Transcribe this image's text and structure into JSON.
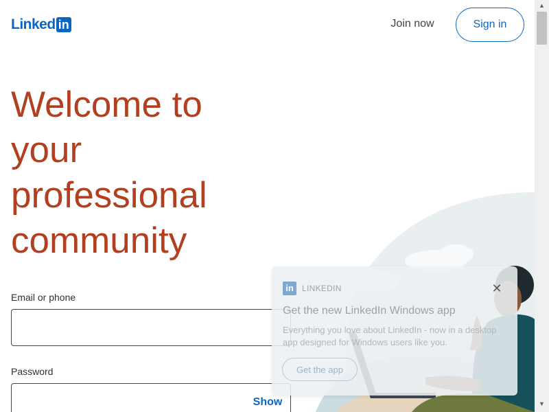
{
  "header": {
    "logo_text": "Linked",
    "logo_box_text": "in",
    "join_now_label": "Join now",
    "sign_in_label": "Sign in"
  },
  "headline": {
    "lines": [
      "Welcome to",
      "your",
      "professional",
      "community"
    ]
  },
  "form": {
    "email_label": "Email or phone",
    "email_value": "",
    "password_label": "Password",
    "password_value": "",
    "show_label": "Show"
  },
  "toast": {
    "app_icon_text": "in",
    "app_name": "LINKEDIN",
    "close_symbol": "✕",
    "title": "Get the new LinkedIn Windows app",
    "body": "Everything you love about LinkedIn - now in a desktop app designed for Windows users like you.",
    "button_label": "Get the app"
  },
  "colors": {
    "brand_blue": "#0a66c2",
    "headline": "#b24020"
  },
  "icons": {
    "scroll_up": "triangle-up-icon",
    "scroll_down": "triangle-down-icon",
    "close": "close-icon"
  }
}
